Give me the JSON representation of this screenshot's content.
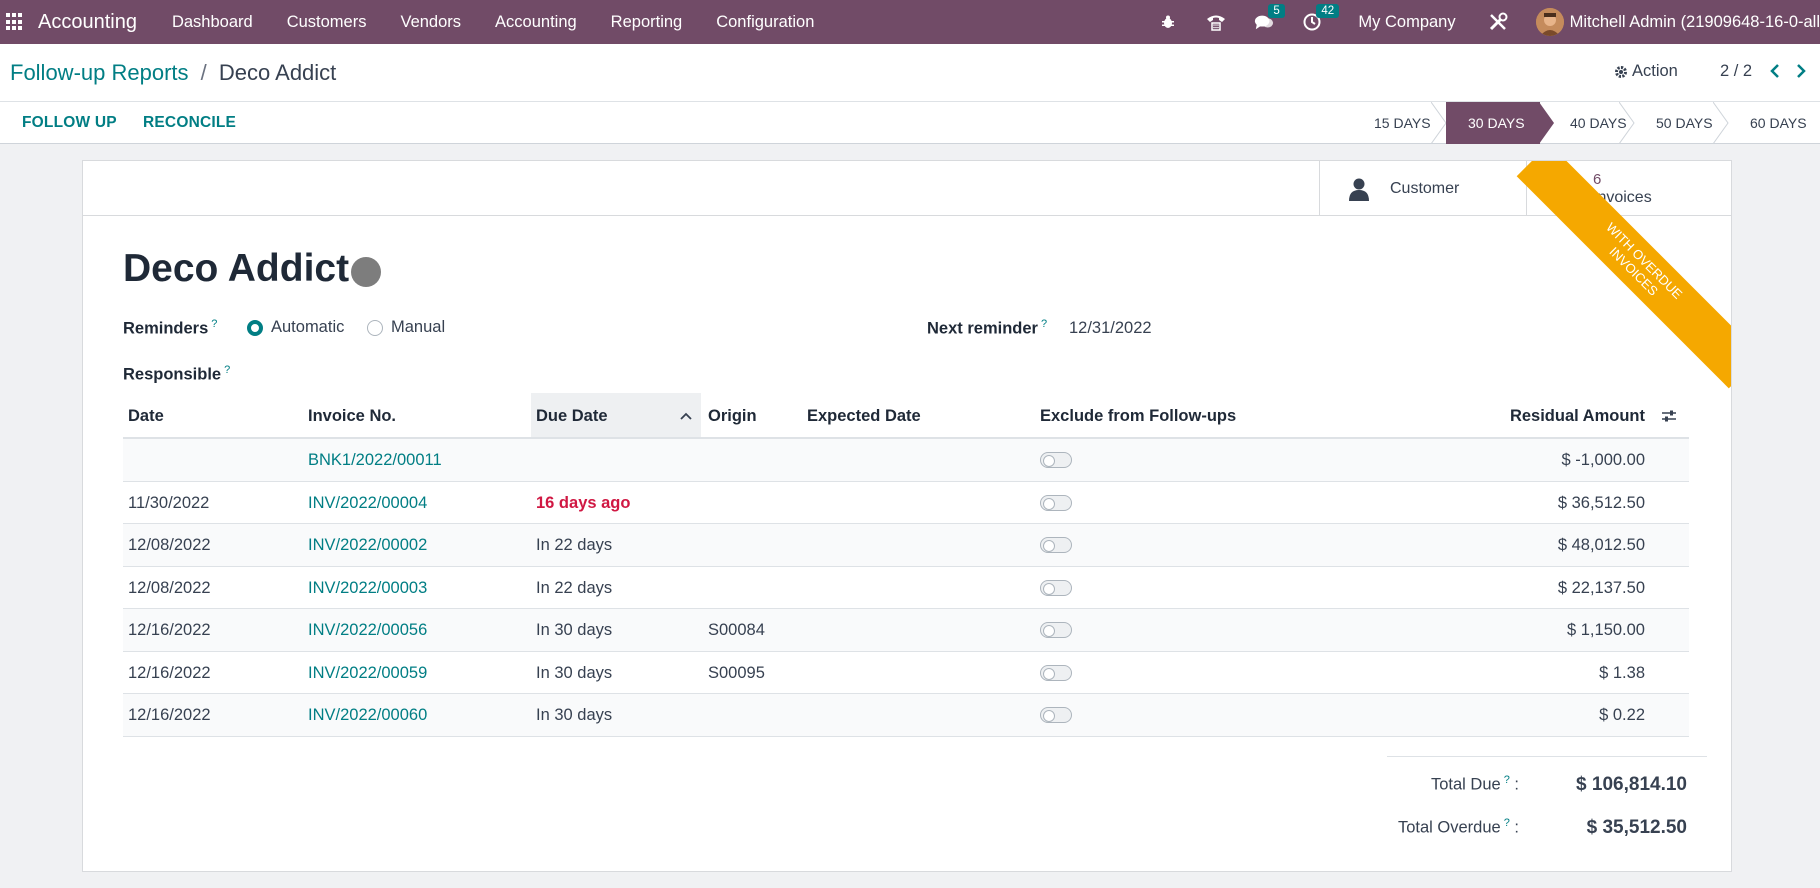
{
  "navbar": {
    "app_name": "Accounting",
    "menu": [
      "Dashboard",
      "Customers",
      "Vendors",
      "Accounting",
      "Reporting",
      "Configuration"
    ],
    "messages_count": "5",
    "activities_count": "42",
    "company": "My Company",
    "user": "Mitchell Admin (21909648-16-0-all"
  },
  "breadcrumb": {
    "parent": "Follow-up Reports",
    "separator": "/",
    "current": "Deco Addict"
  },
  "control": {
    "action_label": "Action",
    "pager": "2 / 2"
  },
  "statusbar": {
    "follow_up_label": "FOLLOW UP",
    "reconcile_label": "RECONCILE",
    "stages": [
      "15 DAYS",
      "30 DAYS",
      "40 DAYS",
      "50 DAYS",
      "60 DAYS"
    ],
    "active_stage": "30 DAYS"
  },
  "sheet": {
    "customer_button": "Customer",
    "invoices_count": "6",
    "invoices_label": "Invoices",
    "ribbon_line1": "WITH OVERDUE",
    "ribbon_line2": "INVOICES",
    "partner_name": "Deco Addict",
    "reminders_label": "Reminders",
    "reminder_options": [
      "Automatic",
      "Manual"
    ],
    "reminder_selected": "Automatic",
    "next_reminder_label": "Next reminder",
    "next_reminder_value": "12/31/2022",
    "responsible_label": "Responsible",
    "tooltip_mark": "?"
  },
  "table": {
    "columns": [
      "Date",
      "Invoice No.",
      "Due Date",
      "Origin",
      "Expected Date",
      "Exclude from Follow-ups",
      "Residual Amount"
    ],
    "rows": [
      {
        "date": "",
        "invoice": "BNK1/2022/00011",
        "due": "",
        "overdue": false,
        "origin": "",
        "expected": "",
        "amount": "$ -1,000.00"
      },
      {
        "date": "11/30/2022",
        "invoice": "INV/2022/00004",
        "due": "16 days ago",
        "overdue": true,
        "origin": "",
        "expected": "",
        "amount": "$ 36,512.50"
      },
      {
        "date": "12/08/2022",
        "invoice": "INV/2022/00002",
        "due": "In 22 days",
        "overdue": false,
        "origin": "",
        "expected": "",
        "amount": "$ 48,012.50"
      },
      {
        "date": "12/08/2022",
        "invoice": "INV/2022/00003",
        "due": "In 22 days",
        "overdue": false,
        "origin": "",
        "expected": "",
        "amount": "$ 22,137.50"
      },
      {
        "date": "12/16/2022",
        "invoice": "INV/2022/00056",
        "due": "In 30 days",
        "overdue": false,
        "origin": "S00084",
        "expected": "",
        "amount": "$ 1,150.00"
      },
      {
        "date": "12/16/2022",
        "invoice": "INV/2022/00059",
        "due": "In 30 days",
        "overdue": false,
        "origin": "S00095",
        "expected": "",
        "amount": "$ 1.38"
      },
      {
        "date": "12/16/2022",
        "invoice": "INV/2022/00060",
        "due": "In 30 days",
        "overdue": false,
        "origin": "",
        "expected": "",
        "amount": "$ 0.22"
      }
    ]
  },
  "totals": {
    "total_due_label": "Total Due",
    "total_due_value": "$ 106,814.10",
    "total_overdue_label": "Total Overdue",
    "total_overdue_value": "$ 35,512.50",
    "colon": ":"
  },
  "colors": {
    "brand": "#714b67",
    "link": "#017e84",
    "overdue": "#d01843",
    "ribbon": "#f5a800"
  }
}
